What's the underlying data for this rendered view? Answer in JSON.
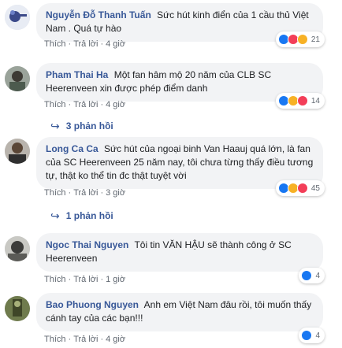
{
  "comments": [
    {
      "author": "Nguyễn Đỗ Thanh Tuấn",
      "text": "Sức hút kinh điển của 1 cầu thủ Việt Nam . Quá tự hào",
      "like": "Thích",
      "reply": "Trả lời",
      "time": "4 giờ",
      "reactions": [
        "like-icon",
        "love-icon",
        "haha-icon"
      ],
      "reaction_count": "21"
    },
    {
      "author": "Pham Thai Ha",
      "text": "Một fan hâm mộ 20 năm của CLB SC Heerenveen xin được phép điểm danh",
      "like": "Thích",
      "reply": "Trả lời",
      "time": "4 giờ",
      "reactions": [
        "like-icon",
        "haha-icon",
        "love-icon"
      ],
      "reaction_count": "14",
      "replies": "3 phản hồi"
    },
    {
      "author": "Long Ca Ca",
      "text": "Sức hút của ngoại binh Van Haauj quá lớn, là fan của SC Heerenveen 25 năm nay, tôi chưa từng thấy điều tương tự, thật ko thể tin đc thật tuyệt vời",
      "like": "Thích",
      "reply": "Trả lời",
      "time": "3 giờ",
      "reactions": [
        "like-icon",
        "haha-icon",
        "love-icon"
      ],
      "reaction_count": "45",
      "replies": "1 phản hồi"
    },
    {
      "author": "Ngoc Thai Nguyen",
      "text": "Tôi tin VĂN HẬU sẽ thành công ở SC Heerenveen",
      "like": "Thích",
      "reply": "Trả lời",
      "time": "1 giờ",
      "reactions": [
        "like-icon"
      ],
      "reaction_count": "4"
    },
    {
      "author": "Bao Phuong Nguyen",
      "text": "Anh em Việt Nam đâu rồi, tôi muốn thấy cánh tay của các bạn!!!",
      "like": "Thích",
      "reply": "Trả lời",
      "time": "4 giờ",
      "reactions": [
        "like-icon"
      ],
      "reaction_count": "4"
    }
  ],
  "colors": {
    "author": "#385898",
    "bubble": "#f2f3f5",
    "meta": "#606770",
    "like": "#1877f2",
    "love": "#f33e58",
    "haha": "#f7b125"
  }
}
